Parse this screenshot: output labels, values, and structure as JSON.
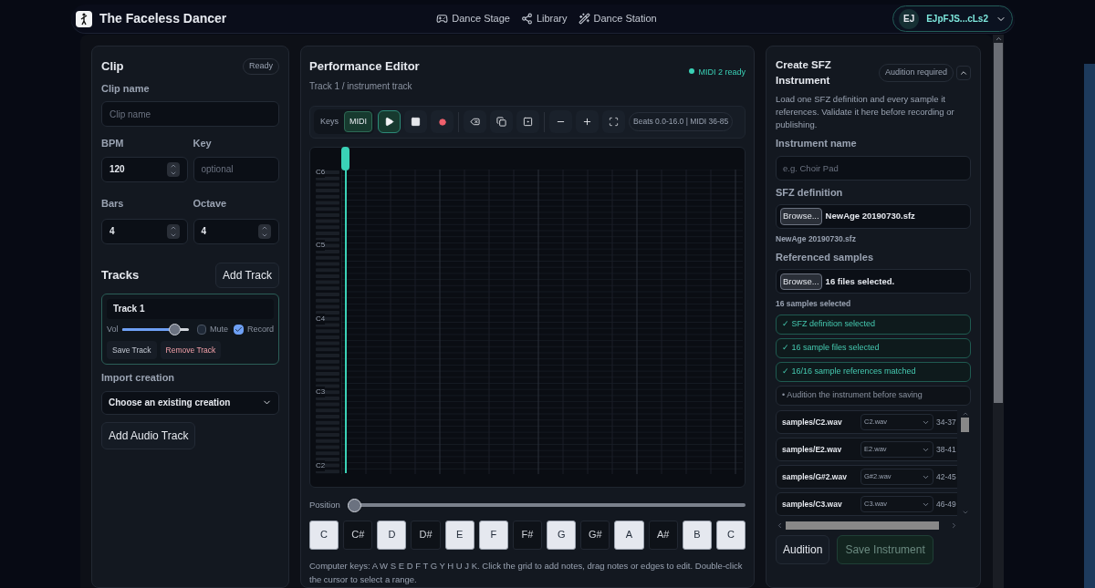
{
  "header": {
    "app_name": "The Faceless Dancer",
    "nav": [
      {
        "label": "Dance Stage",
        "kind": "stage"
      },
      {
        "label": "Library",
        "kind": "library"
      },
      {
        "label": "Dance Station",
        "kind": "station"
      }
    ],
    "account": {
      "initials": "EJ",
      "name": "EJpFJS...cLs2"
    }
  },
  "clip": {
    "title": "Clip",
    "status": "Ready",
    "clip_name": {
      "label": "Clip name",
      "placeholder": "Clip name"
    },
    "bpm": {
      "label": "BPM",
      "value": "120"
    },
    "key": {
      "label": "Key",
      "placeholder": "optional"
    },
    "bars": {
      "label": "Bars",
      "value": "4"
    },
    "octave": {
      "label": "Octave",
      "value": "4"
    },
    "tracks_title": "Tracks",
    "add_track": "Add Track",
    "track": {
      "name": "Track 1",
      "vol_label": "Vol",
      "level": 0.8,
      "mute_label": "Mute",
      "mute": false,
      "record_label": "Record",
      "record": true,
      "save": "Save Track",
      "remove": "Remove Track"
    },
    "import_label": "Import creation",
    "import_value": "Choose an existing creation",
    "add_audio": "Add Audio Track"
  },
  "editor": {
    "title": "Performance Editor",
    "subtitle": "Track 1 / instrument track",
    "status": "MIDI 2 ready",
    "modes": [
      {
        "label": "Keys",
        "selected": false
      },
      {
        "label": "MIDI",
        "selected": true
      }
    ],
    "tools": [
      {
        "kind": "play",
        "selected": true
      },
      {
        "kind": "stop",
        "selected": false
      },
      {
        "kind": "record",
        "selected": false
      },
      {
        "kind": "erase",
        "selected": false
      },
      {
        "kind": "duplicate",
        "selected": false
      },
      {
        "kind": "select",
        "selected": false
      },
      {
        "kind": "zoom-out",
        "selected": false
      },
      {
        "kind": "zoom-in",
        "selected": false
      },
      {
        "kind": "fit",
        "selected": false
      }
    ],
    "range": "Beats 0.0-16.0 | MIDI 36-85",
    "octave_labels": [
      "C6",
      "C5",
      "C4",
      "C3",
      "C2"
    ],
    "position_label": "Position",
    "position": {
      "level": 0
    },
    "keys": [
      {
        "label": "C",
        "kind": "white"
      },
      {
        "label": "C#",
        "kind": "black"
      },
      {
        "label": "D",
        "kind": "white"
      },
      {
        "label": "D#",
        "kind": "black"
      },
      {
        "label": "E",
        "kind": "white"
      },
      {
        "label": "F",
        "kind": "white"
      },
      {
        "label": "F#",
        "kind": "black"
      },
      {
        "label": "G",
        "kind": "white"
      },
      {
        "label": "G#",
        "kind": "black"
      },
      {
        "label": "A",
        "kind": "white"
      },
      {
        "label": "A#",
        "kind": "black"
      },
      {
        "label": "B",
        "kind": "white"
      },
      {
        "label": "C",
        "kind": "white"
      }
    ],
    "help": "Computer keys: A W S E D F T G Y H U J K. Click the grid to add notes, drag notes or edges to edit. Double-click the cursor to select a range."
  },
  "sfz": {
    "title": "Create SFZ Instrument",
    "badge": "Audition required",
    "description": "Load one SFZ definition and every sample it references. Validate it here before recording or publishing.",
    "instrument_name": {
      "label": "Instrument name",
      "placeholder": "e.g. Choir Pad"
    },
    "definition": {
      "label": "SFZ definition",
      "button": "Browse...",
      "value": "NewAge 20190730.sfz",
      "note": "NewAge 20190730.sfz"
    },
    "samples": {
      "label": "Referenced samples",
      "button": "Browse...",
      "value": "16 files selected.",
      "note": "16 samples selected"
    },
    "checks": [
      {
        "text": "✓ SFZ definition selected",
        "done": true
      },
      {
        "text": "✓ 16 sample files selected",
        "done": true
      },
      {
        "text": "✓ 16/16 sample references matched",
        "done": true
      },
      {
        "text": "• Audition the instrument before saving",
        "done": false
      }
    ],
    "rows": [
      {
        "path": "samples/C2.wav",
        "file": "C2.wav",
        "range": "34-37"
      },
      {
        "path": "samples/E2.wav",
        "file": "E2.wav",
        "range": "38-41"
      },
      {
        "path": "samples/G#2.wav",
        "file": "G#2.wav",
        "range": "42-45"
      },
      {
        "path": "samples/C3.wav",
        "file": "C3.wav",
        "range": "46-49"
      }
    ],
    "audition": "Audition",
    "save": {
      "label": "Save Instrument",
      "disabled": true
    }
  }
}
